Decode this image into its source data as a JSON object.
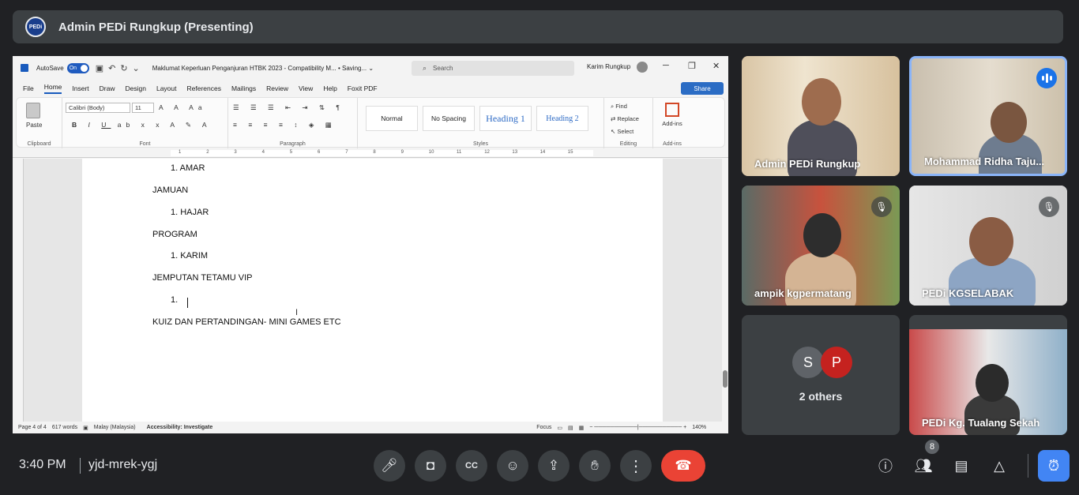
{
  "banner": {
    "logo_text": "PEDi",
    "title": "Admin PEDi Rungkup (Presenting)"
  },
  "word": {
    "autosave_label": "AutoSave",
    "autosave_state": "On",
    "doc_title": "Maklumat Keperluan Penganjuran HTBK 2023  -  Compatibility M...  •  Saving... ⌄",
    "search_placeholder": "Search",
    "user_name": "Karim Rungkup",
    "menu": [
      "File",
      "Home",
      "Insert",
      "Draw",
      "Design",
      "Layout",
      "References",
      "Mailings",
      "Review",
      "View",
      "Help",
      "Foxit PDF"
    ],
    "share_label": "Share",
    "ribbon": {
      "clipboard_label": "Clipboard",
      "paste_label": "Paste",
      "font_name": "Calibri (Body)",
      "font_size": "11",
      "font_label": "Font",
      "paragraph_label": "Paragraph",
      "styles_label": "Styles",
      "styles": [
        "Normal",
        "No Spacing",
        "Heading 1",
        "Heading 2"
      ],
      "editing_label": "Editing",
      "find_label": "Find",
      "replace_label": "Replace",
      "select_label": "Select",
      "addins_label": "Add-ins"
    },
    "ruler_numbers": [
      "1",
      "2",
      "3",
      "4",
      "5",
      "6",
      "7",
      "8",
      "9",
      "10",
      "11",
      "12",
      "13",
      "14",
      "15"
    ],
    "document_lines": {
      "l1": "1.    AMAR",
      "l2": "JAMUAN",
      "l3": "1.    HAJAR",
      "l4": "PROGRAM",
      "l5": "1.    KARIM",
      "l6": "JEMPUTAN TETAMU VIP",
      "l7": "1.",
      "l8": "KUIZ DAN PERTANDINGAN- MINI GAMES ETC"
    },
    "status": {
      "page": "Page 4 of 4",
      "words": "617 words",
      "language": "Malay (Malaysia)",
      "accessibility": "Accessibility: Investigate",
      "focus": "Focus",
      "zoom": "140%"
    }
  },
  "participants": [
    {
      "name": "Admin PEDi Rungkup"
    },
    {
      "name": "Mohammad Ridha Taju..."
    },
    {
      "name": "ampik kgpermatang"
    },
    {
      "name": "PEDi KGSELABAK"
    },
    {
      "name": "PEDi Kg. Tualang Sekah"
    }
  ],
  "others_tile": {
    "avatar1": "S",
    "avatar2": "P",
    "label": "2 others"
  },
  "bottom": {
    "time": "3:40 PM",
    "meeting_code": "yjd-mrek-ygj",
    "participant_count": "8"
  },
  "colors": {
    "end_call": "#ea4335",
    "accent": "#8ab4f8",
    "word_blue": "#185abd"
  }
}
